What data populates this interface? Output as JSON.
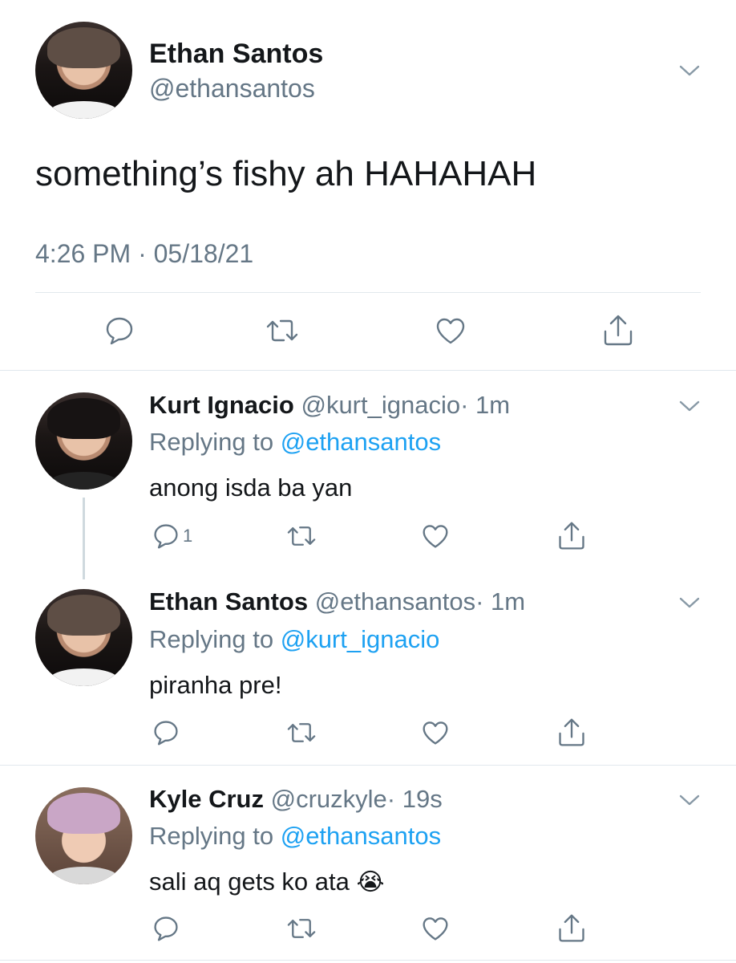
{
  "main_tweet": {
    "name": "Ethan Santos",
    "handle": "@ethansantos",
    "text": "something’s fishy ah HAHAHAH",
    "timestamp": "4:26 PM · 05/18/21",
    "actions": [
      "reply-icon",
      "retweet-icon",
      "like-icon",
      "share-icon"
    ]
  },
  "replies": [
    {
      "name": "Kurt Ignacio",
      "handle": "@kurt_ignacio",
      "time": "· 1m",
      "replying_label": "Replying to",
      "replying_to": "@ethansantos",
      "text": "anong isda ba yan",
      "reply_count": "1"
    },
    {
      "name": "Ethan Santos",
      "handle": "@ethansantos",
      "time": "· 1m",
      "replying_label": "Replying to",
      "replying_to": "@kurt_ignacio",
      "text": "piranha pre!",
      "reply_count": ""
    },
    {
      "name": "Kyle Cruz",
      "handle": "@cruzkyle",
      "time": "· 19s",
      "replying_label": "Replying to",
      "replying_to": "@ethansantos",
      "text": "sali aq gets ko ata",
      "emoji": "😭",
      "reply_count": ""
    }
  ],
  "colors": {
    "link": "#1da1f2",
    "secondary_text": "#657786",
    "divider": "#e1e8ed",
    "icon": "#657786"
  }
}
